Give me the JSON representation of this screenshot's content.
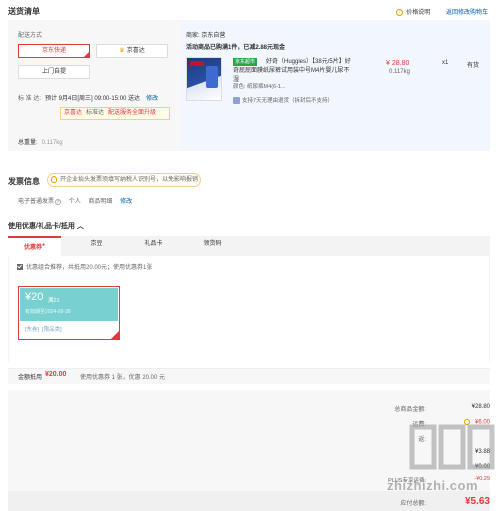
{
  "header": {
    "title": "送货清单",
    "price_note": "价格说明",
    "back_to_cart": "返回修改购物车"
  },
  "delivery": {
    "label": "配送方式",
    "options": [
      "京东快递",
      "京喜达",
      "上门自提"
    ],
    "date_label": "标 准 达:",
    "date_value": "预计 9月4日[周三] 09:00-15:00 送达",
    "date_edit": "修改",
    "upgrade_tags": [
      "京喜达",
      "标准达"
    ],
    "upgrade_text": "配送服务全面升级",
    "total_weight_label": "总重量:",
    "total_weight_value": "0.117kg"
  },
  "store": {
    "seller": "商家: 京东自营",
    "promo": "活动商品已购满1件，已减2.88元现金",
    "product": {
      "badge": "京东超市",
      "name": "好奇（Huggies）【38元/5片】好奇屁屁面膜纸尿裤试用装中号M4片婴儿尿不湿",
      "color": "颜色: 纸尿裤M4(6-1...",
      "service": "支持7天无理由退货（拆封后不支持）",
      "price": "¥ 28.80",
      "weight": "0.117kg",
      "qty": "x1",
      "stock": "有货"
    }
  },
  "invoice": {
    "title": "发票信息",
    "tip": "开企业抬头发票须填写纳税人识别号，以免影响报销",
    "type": "电子普通发票",
    "holder": "个人",
    "content": "商品明细",
    "edit": "修改"
  },
  "coupons": {
    "title": "使用优惠/礼品卡/抵用",
    "tabs": [
      "优惠券",
      "京豆",
      "礼品卡",
      "领货码"
    ],
    "recommend_text": "优惠组合推荐，共抵用20.00元；使用优惠券1张",
    "card": {
      "amount": "¥20",
      "condition": "满21",
      "valid": "有效期至2024-09-30",
      "tags": [
        "[东券]",
        "[限品类]"
      ]
    },
    "summary_label": "金额抵用",
    "summary_amount": "¥20.00",
    "summary_detail": "使用优惠券 1 张，优惠 20.00 元"
  },
  "totals": {
    "total_label": "总商品金额:",
    "total_value": "¥28.80",
    "shipping_label": "运费:",
    "shipping_value": "¥6.00",
    "row3_label": "返:",
    "row4_value": "¥3.88",
    "row5_value": "¥0.00",
    "plus_label": "PLUS专享运费:",
    "plus_value": "-¥0.29",
    "pay_label": "应付总额:",
    "pay_value": "¥5.63"
  },
  "watermark": {
    "text": "zhizhizhi.com"
  },
  "colors": {
    "accent_red": "#e4393c",
    "coupon_teal": "#78d0d0",
    "link_blue": "#005ea7"
  }
}
